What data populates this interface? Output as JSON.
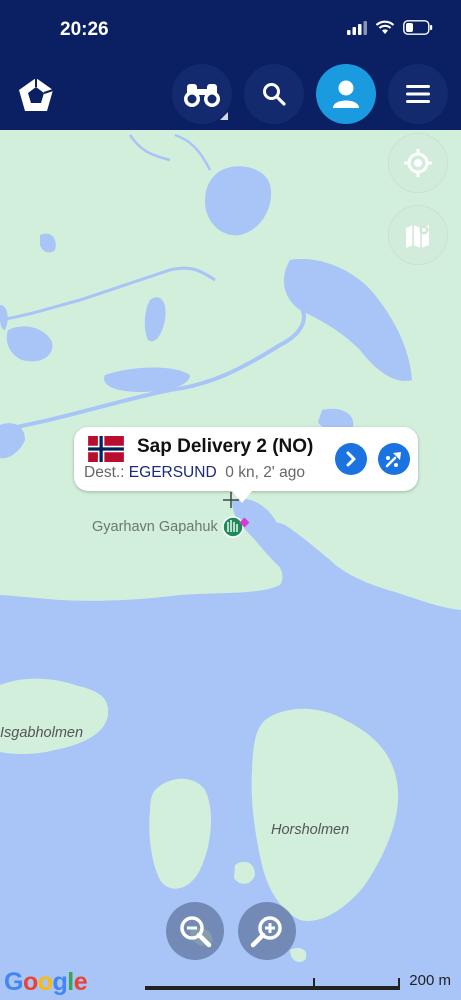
{
  "status_bar": {
    "time": "20:26"
  },
  "app_bar": {
    "logo_icon": "pentagon-logo-icon",
    "buttons": [
      {
        "name": "binoculars-button",
        "icon": "binoculars-icon"
      },
      {
        "name": "search-button",
        "icon": "search-icon"
      },
      {
        "name": "profile-button",
        "icon": "user-icon"
      },
      {
        "name": "menu-button",
        "icon": "hamburger-menu-icon"
      }
    ]
  },
  "map": {
    "labels": {
      "place": "Gyarhavn Gapahuk",
      "island_left": "Isgabholmen",
      "island_right": "Horsholmen"
    },
    "side_buttons": [
      "locate-icon",
      "map-layers-icon"
    ],
    "colors": {
      "land": "#d2efdb",
      "water": "#a9c4f7",
      "header": "#0b1f63",
      "accent": "#1a73e0"
    }
  },
  "vessel_popup": {
    "name": "Sap Delivery 2 (NO)",
    "dest_label": "Dest.:",
    "destination": "EGERSUND",
    "speed_time": "0 kn, 2' ago",
    "flag": "norway-flag"
  },
  "controls": {
    "zoom_out_icon": "zoom-out-icon",
    "zoom_in_icon": "zoom-in-icon",
    "scale_label": "200 m",
    "attribution": "Google"
  }
}
